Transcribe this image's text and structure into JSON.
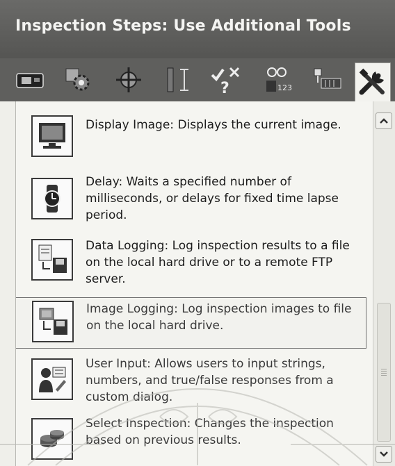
{
  "header": {
    "title": "Inspection Steps: Use Additional Tools"
  },
  "toolbar": {
    "tools": [
      {
        "icon": "camera-icon"
      },
      {
        "icon": "gear-search-icon"
      },
      {
        "icon": "crosshair-icon"
      },
      {
        "icon": "measure-icon"
      },
      {
        "icon": "check-question-icon"
      },
      {
        "icon": "counter-icon"
      },
      {
        "icon": "io-icon"
      },
      {
        "icon": "tools-icon",
        "active": true
      }
    ]
  },
  "steps": [
    {
      "icon": "display-image-icon",
      "text": "Display Image:  Displays the current image."
    },
    {
      "icon": "delay-icon",
      "text": "Delay:  Waits a specified number of milliseconds, or delays for fixed time lapse period."
    },
    {
      "icon": "data-logging-icon",
      "text": "Data Logging:  Log inspection results to a file on the local hard drive or to a remote FTP server."
    },
    {
      "icon": "image-logging-icon",
      "text": "Image Logging:  Log inspection images to file on the local hard drive.",
      "selected": true
    },
    {
      "icon": "user-input-icon",
      "text": "User Input:  Allows users to input strings, numbers, and true/false responses from a custom dialog."
    },
    {
      "icon": "select-inspection-icon",
      "text": "Select Inspection:  Changes the inspection based on previous results."
    }
  ]
}
